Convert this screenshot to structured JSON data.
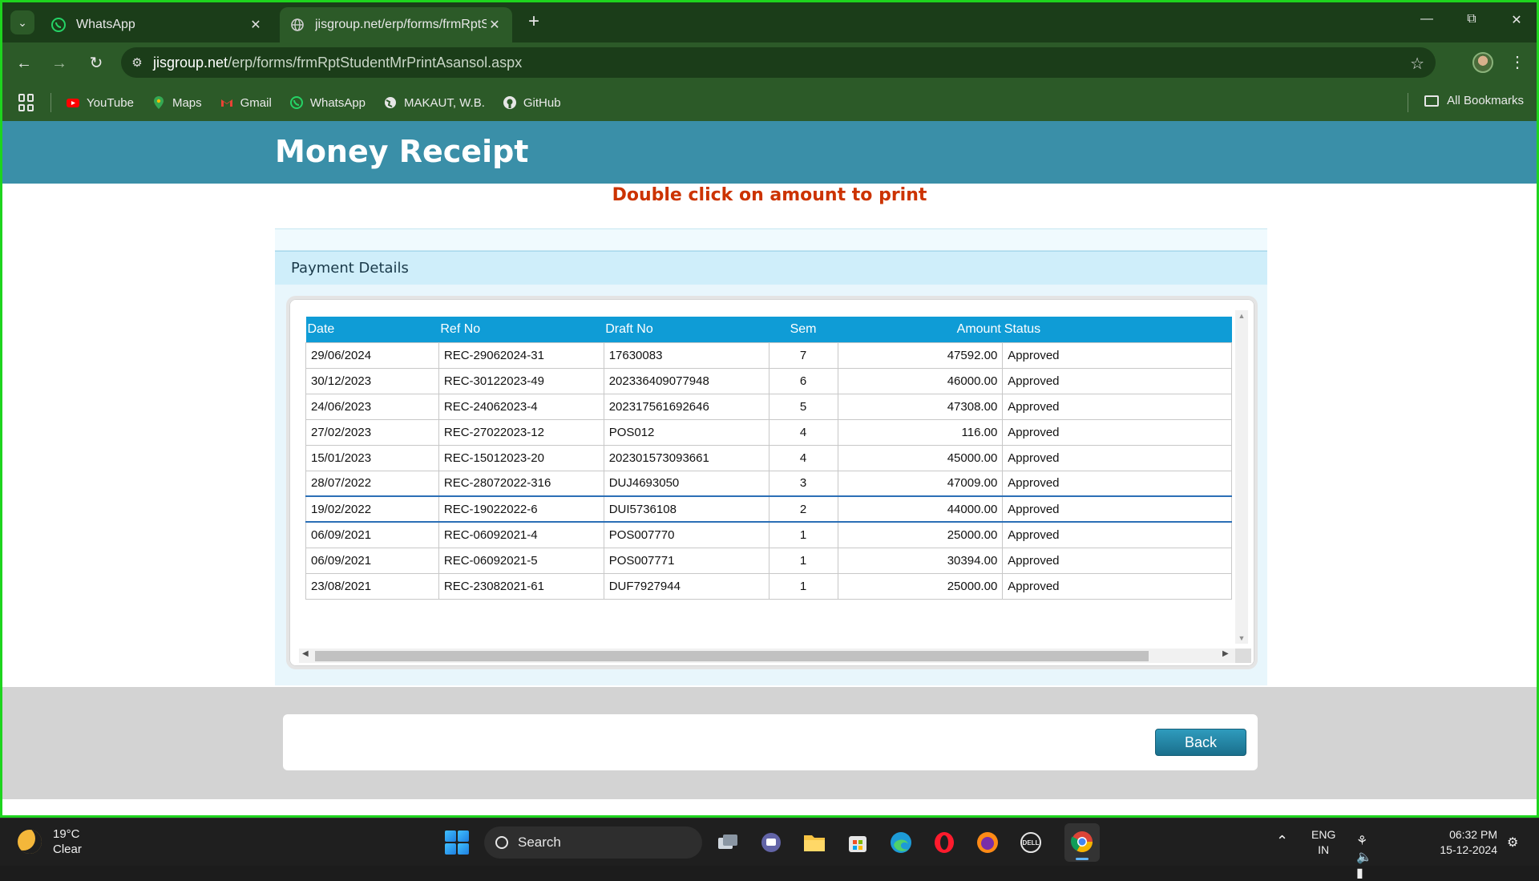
{
  "browser": {
    "tabs": [
      {
        "title": "WhatsApp",
        "icon": "whatsapp-icon"
      },
      {
        "title": "jisgroup.net/erp/forms/frmRptS",
        "icon": "globe-icon"
      }
    ],
    "address": {
      "domain": "jisgroup.net",
      "path": "/erp/forms/frmRptStudentMrPrintAsansol.aspx"
    },
    "bookmarks": [
      {
        "label": "YouTube",
        "icon": "youtube-icon",
        "color": "#ff0000"
      },
      {
        "label": "Maps",
        "icon": "maps-icon",
        "color": "#34a853"
      },
      {
        "label": "Gmail",
        "icon": "gmail-icon",
        "color": "#ea4335"
      },
      {
        "label": "WhatsApp",
        "icon": "whatsapp-icon",
        "color": "#25d366"
      },
      {
        "label": "MAKAUT, W.B.",
        "icon": "globe-icon",
        "color": "#e6e6e6"
      },
      {
        "label": "GitHub",
        "icon": "github-icon",
        "color": "#e6e6e6"
      }
    ],
    "all_bookmarks": "All Bookmarks"
  },
  "page": {
    "title": "Money Receipt",
    "instruction": "Double click on amount to print",
    "panel_heading": "Payment Details",
    "columns": {
      "date": "Date",
      "ref": "Ref No",
      "draft": "Draft No",
      "sem": "Sem",
      "amount": "Amount",
      "status": "Status"
    },
    "rows": [
      {
        "date": "29/06/2024",
        "ref": "REC-29062024-31",
        "draft": "17630083",
        "sem": "7",
        "amount": "47592.00",
        "status": "Approved"
      },
      {
        "date": "30/12/2023",
        "ref": "REC-30122023-49",
        "draft": "202336409077948",
        "sem": "6",
        "amount": "46000.00",
        "status": "Approved"
      },
      {
        "date": "24/06/2023",
        "ref": "REC-24062023-4",
        "draft": "202317561692646",
        "sem": "5",
        "amount": "47308.00",
        "status": "Approved"
      },
      {
        "date": "27/02/2023",
        "ref": "REC-27022023-12",
        "draft": "POS012",
        "sem": "4",
        "amount": "116.00",
        "status": "Approved"
      },
      {
        "date": "15/01/2023",
        "ref": "REC-15012023-20",
        "draft": "202301573093661",
        "sem": "4",
        "amount": "45000.00",
        "status": "Approved"
      },
      {
        "date": "28/07/2022",
        "ref": "REC-28072022-316",
        "draft": "DUJ4693050",
        "sem": "3",
        "amount": "47009.00",
        "status": "Approved"
      },
      {
        "date": "19/02/2022",
        "ref": "REC-19022022-6",
        "draft": "DUI5736108",
        "sem": "2",
        "amount": "44000.00",
        "status": "Approved"
      },
      {
        "date": "06/09/2021",
        "ref": "REC-06092021-4",
        "draft": "POS007770",
        "sem": "1",
        "amount": "25000.00",
        "status": "Approved"
      },
      {
        "date": "06/09/2021",
        "ref": "REC-06092021-5",
        "draft": "POS007771",
        "sem": "1",
        "amount": "30394.00",
        "status": "Approved"
      },
      {
        "date": "23/08/2021",
        "ref": "REC-23082021-61",
        "draft": "DUF7927944",
        "sem": "1",
        "amount": "25000.00",
        "status": "Approved"
      }
    ],
    "back_label": "Back",
    "colors": {
      "header": "#3a8fa8",
      "grid_header": "#0f9cd6",
      "instruction": "#cc3300"
    }
  },
  "taskbar": {
    "weather": {
      "temp": "19°C",
      "condition": "Clear"
    },
    "search_label": "Search",
    "lang_top": "ENG",
    "lang_bottom": "IN",
    "time": "06:32 PM",
    "date": "15-12-2024"
  }
}
